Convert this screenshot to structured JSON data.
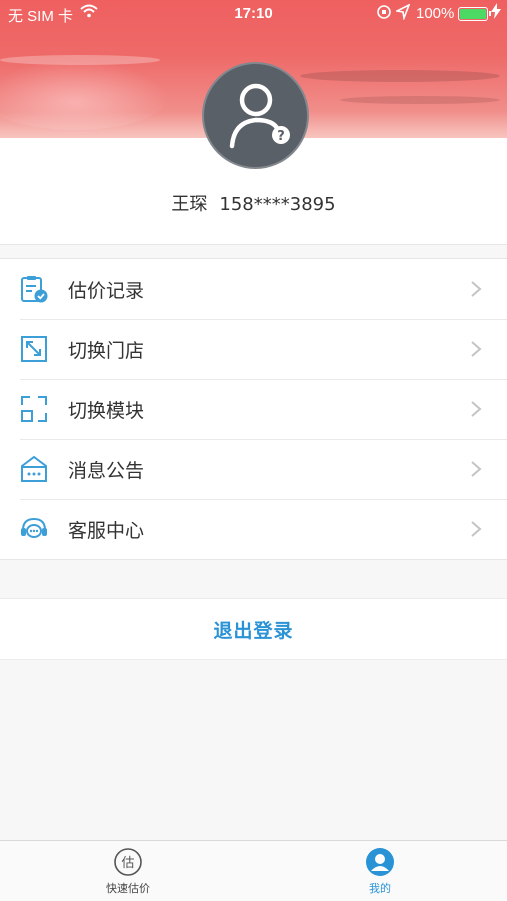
{
  "status_bar": {
    "carrier": "无 SIM 卡",
    "time": "17:10",
    "battery": "100%"
  },
  "profile": {
    "name": "王琛",
    "phone": "158****3895"
  },
  "menu": {
    "items": [
      {
        "label": "估价记录",
        "icon": "clipboard-check-icon"
      },
      {
        "label": "切换门店",
        "icon": "switch-store-icon"
      },
      {
        "label": "切换模块",
        "icon": "switch-module-icon"
      },
      {
        "label": "消息公告",
        "icon": "announcement-icon"
      },
      {
        "label": "客服中心",
        "icon": "headset-icon"
      }
    ]
  },
  "logout_label": "退出登录",
  "tabbar": {
    "tabs": [
      {
        "label": "快速估价",
        "icon_text": "估",
        "active": false
      },
      {
        "label": "我的",
        "active": true
      }
    ]
  },
  "colors": {
    "accent": "#2a93d6",
    "icon": "#3d9fd8",
    "banner": "#ef5f60"
  }
}
